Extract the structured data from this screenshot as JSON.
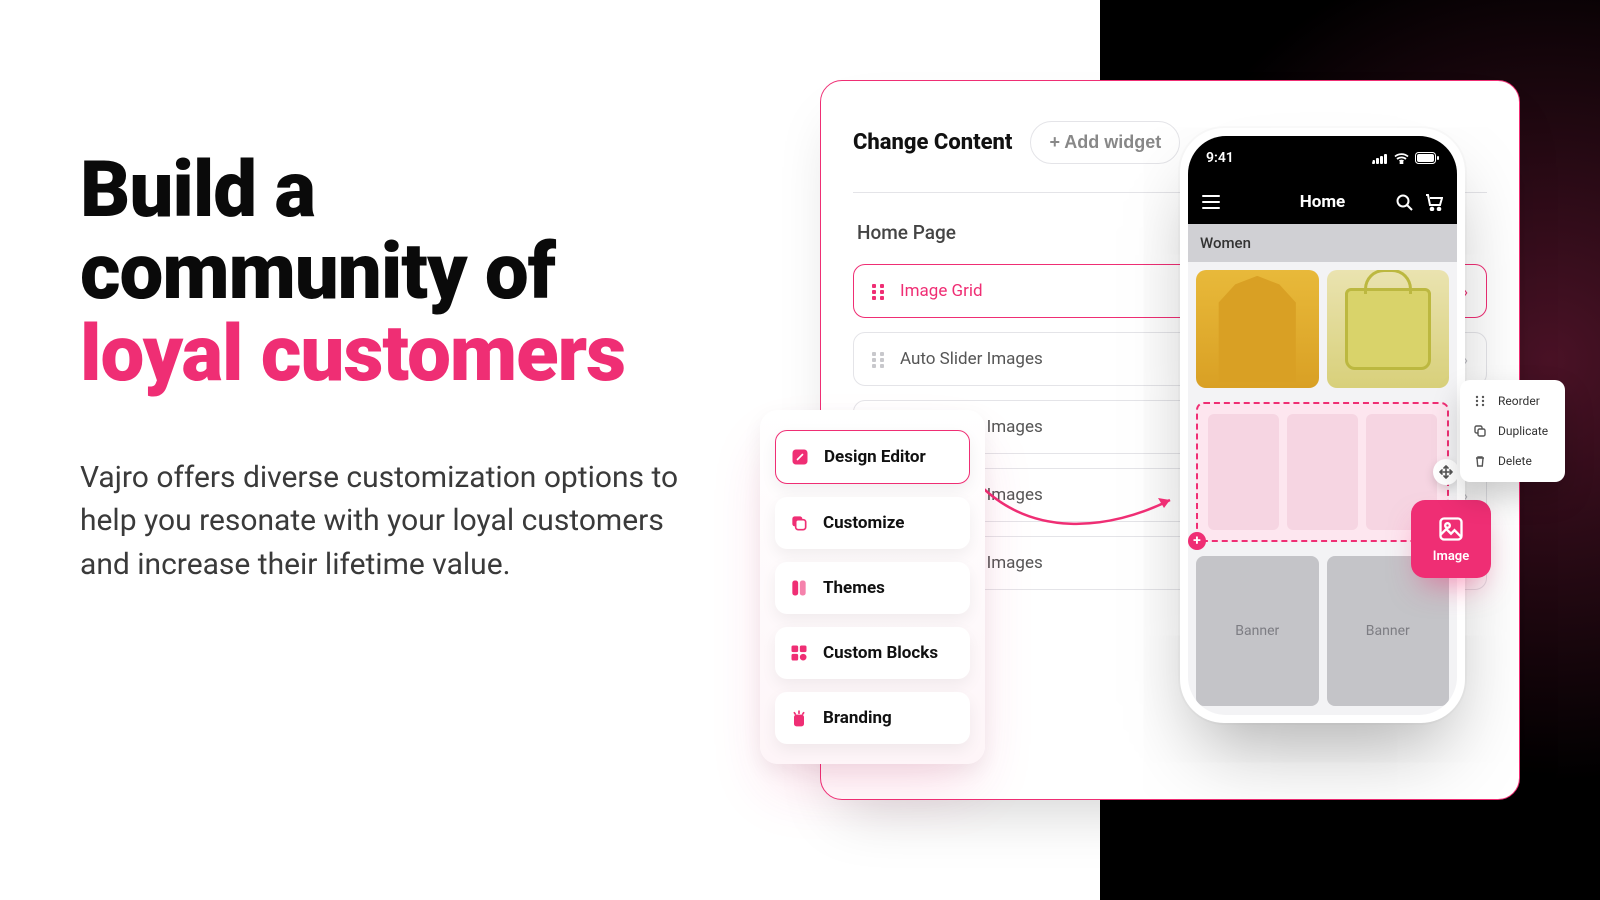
{
  "hero": {
    "title_line1": "Build a",
    "title_line2": "community of",
    "title_accent": "loyal customers",
    "body": "Vajro offers diverse customization options to help you resonate with your loyal customers and increase their lifetime value."
  },
  "panel": {
    "title": "Change Content",
    "add_widget_label": "+ Add widget",
    "section_label": "Home Page",
    "widgets": [
      {
        "label": "Image Grid",
        "active": true
      },
      {
        "label": "Auto Slider Images",
        "active": false
      },
      {
        "label": "Auto Slider Images",
        "active": false
      },
      {
        "label": "Auto Slider Images",
        "active": false
      },
      {
        "label": "Auto Slider Images",
        "active": false
      }
    ]
  },
  "side_menu": {
    "items": [
      {
        "label": "Design Editor",
        "icon": "edit-square-icon",
        "active": true
      },
      {
        "label": "Customize",
        "icon": "layers-icon",
        "active": false
      },
      {
        "label": "Themes",
        "icon": "palette-icon",
        "active": false
      },
      {
        "label": "Custom Blocks",
        "icon": "grid-icon",
        "active": false
      },
      {
        "label": "Branding",
        "icon": "brand-icon",
        "active": false
      }
    ]
  },
  "phone": {
    "time": "9:41",
    "app_title": "Home",
    "category_tab": "Women",
    "banner_label": "Banner"
  },
  "image_fab": {
    "label": "Image"
  },
  "ctx_menu": {
    "items": [
      {
        "label": "Reorder",
        "icon": "grip-icon"
      },
      {
        "label": "Duplicate",
        "icon": "copy-icon"
      },
      {
        "label": "Delete",
        "icon": "trash-icon"
      }
    ]
  }
}
